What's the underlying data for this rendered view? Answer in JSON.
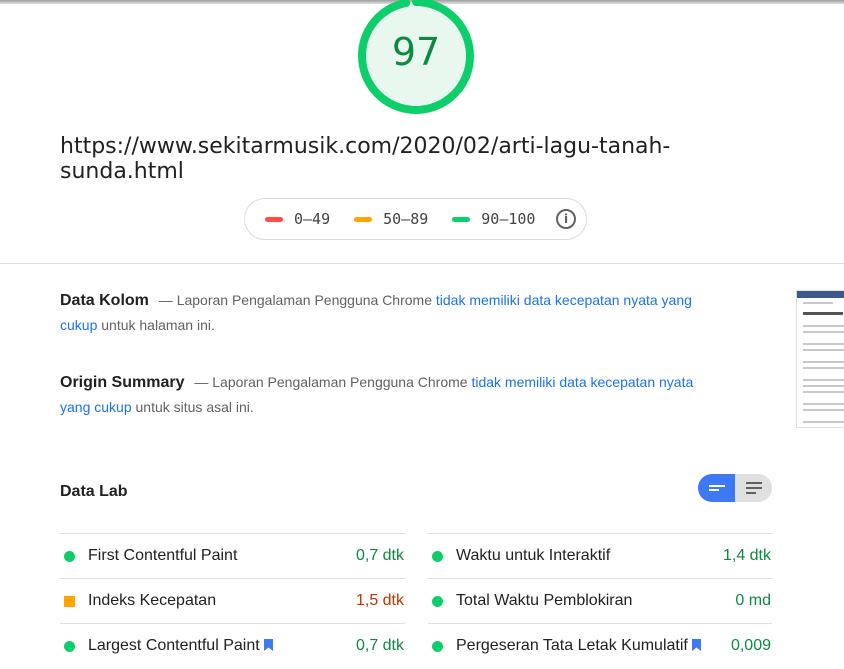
{
  "report": {
    "score": "97",
    "url": "https://www.sekitarmusik.com/2020/02/arti-lagu-tanah-sunda.html"
  },
  "legend": [
    {
      "label": "0–49",
      "color": "#ff4e42"
    },
    {
      "label": "50–89",
      "color": "#ffa400"
    },
    {
      "label": "90–100",
      "color": "#0cce6b"
    }
  ],
  "legend_info_glyph": "i",
  "colors": {
    "pass": "#0cce6b",
    "pass_text": "#0d8a3f",
    "average": "#ffa400",
    "average_text": "#c33300",
    "link": "#1a73e8",
    "toggle_active": "#3d78f5"
  },
  "field_data": {
    "title": "Data Kolom",
    "dash": "—",
    "text_before": "Laporan Pengalaman Pengguna Chrome",
    "link": "tidak memiliki data kecepatan nyata yang cukup",
    "text_after": "untuk halaman ini."
  },
  "origin_summary": {
    "title": "Origin Summary",
    "dash": "—",
    "text_before": "Laporan Pengalaman Pengguna Chrome",
    "link": "tidak memiliki data kecepatan nyata yang cukup",
    "text_after": "untuk situs asal ini."
  },
  "lab_data": {
    "title": "Data Lab",
    "metrics_left": [
      {
        "label": "First Contentful Paint",
        "value": "0,7 dtk",
        "status": "pass",
        "flag": false
      },
      {
        "label": "Indeks Kecepatan",
        "value": "1,5 dtk",
        "status": "average",
        "flag": false
      },
      {
        "label": "Largest Contentful Paint",
        "value": "0,7 dtk",
        "status": "pass",
        "flag": true
      }
    ],
    "metrics_right": [
      {
        "label": "Waktu untuk Interaktif",
        "value": "1,4 dtk",
        "status": "pass",
        "flag": false
      },
      {
        "label": "Total Waktu Pemblokiran",
        "value": "0 md",
        "status": "pass",
        "flag": false
      },
      {
        "label": "Pergeseran Tata Letak Kumulatif",
        "value": "0,009",
        "status": "pass",
        "flag": true
      }
    ]
  },
  "icons": {
    "view_toggle_active": "bar-list-icon",
    "view_toggle_inactive": "text-lines-icon",
    "flag": "bookmark-flag-icon"
  }
}
